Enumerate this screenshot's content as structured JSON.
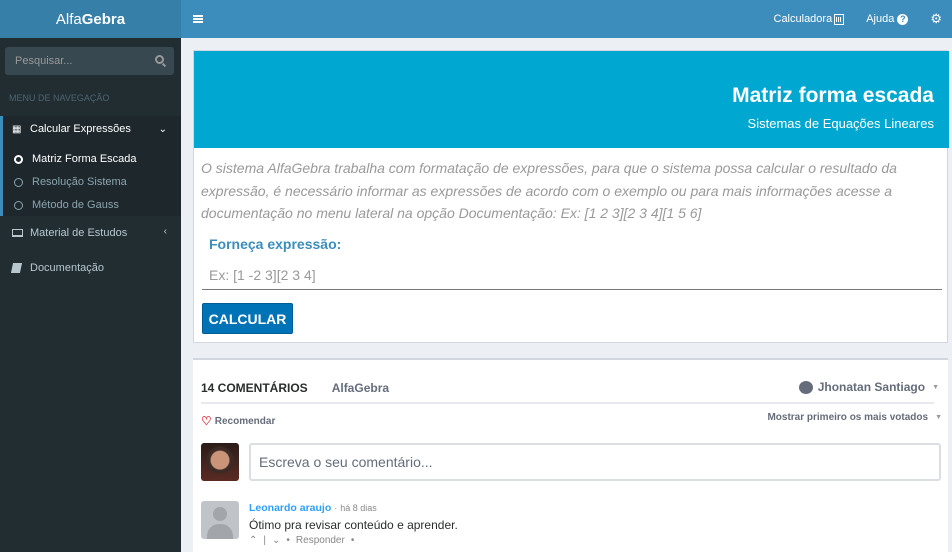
{
  "app": {
    "logo_prefix": "Alfa",
    "logo_suffix": "Gebra"
  },
  "topnav": {
    "calculator": "Calculadora",
    "help": "Ajuda"
  },
  "sidebar": {
    "search_placeholder": "Pesquisar...",
    "nav_header": "MENU DE NAVEGAÇÃO",
    "items": [
      {
        "label": "Calcular Expressões",
        "icon": "calculator-icon"
      },
      {
        "label": "Material de Estudos",
        "icon": "laptop-icon"
      },
      {
        "label": "Documentação",
        "icon": "book-icon"
      }
    ],
    "subitems": [
      {
        "label": "Matriz Forma Escada",
        "active": true
      },
      {
        "label": "Resolução Sistema",
        "active": false
      },
      {
        "label": "Método de Gauss",
        "active": false
      }
    ]
  },
  "main": {
    "title": "Matriz forma escada",
    "subtitle": "Sistemas de Equações Lineares",
    "description": "O sistema AlfaGebra trabalha com formatação de expressões, para que o sistema possa calcular o resultado da expressão, é necessário informar as expressões de acordo com o exemplo ou para mais informações acesse a documentação no menu lateral na opção Documentação: Ex: [1 2 3][2 3 4][1 5 6]",
    "input_label": "Forneça expressão:",
    "input_placeholder": "Ex: [1 -2 3][2 3 4]",
    "button": "CALCULAR"
  },
  "comments": {
    "tab_count": "14 COMENTÁRIOS",
    "tab_site": "AlfaGebra",
    "user": "Jhonatan Santiago",
    "recommend": "Recomendar",
    "sort": "Mostrar primeiro os mais votados",
    "placeholder": "Escreva o seu comentário...",
    "items": [
      {
        "author": "Leonardo araujo",
        "date": "há 8 dias",
        "text": "Ótimo pra revisar conteúdo e aprender.",
        "reply": "Responder"
      }
    ]
  },
  "colors": {
    "topbar": "#3c8dbc",
    "logo_bg": "#367fa9",
    "sidebar": "#222d32",
    "banner": "#00a7d0",
    "button": "#0073b7"
  }
}
